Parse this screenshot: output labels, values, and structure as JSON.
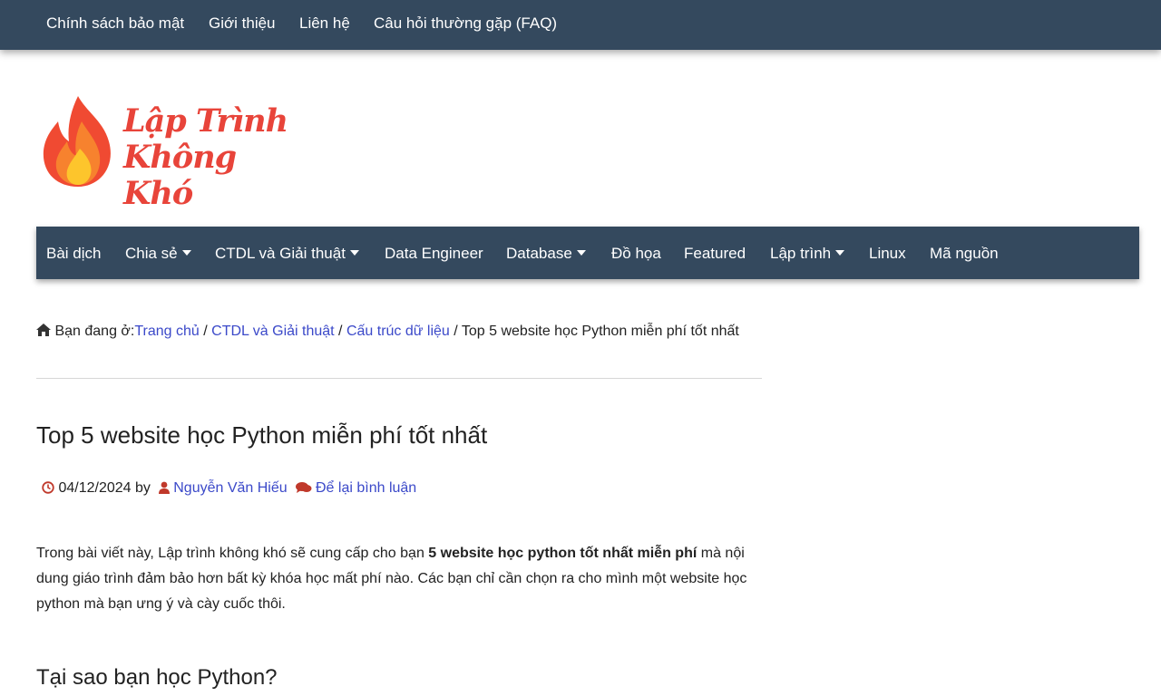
{
  "topbar": {
    "links": [
      "Chính sách bảo mật",
      "Giới thiệu",
      "Liên hệ",
      "Câu hỏi thường gặp (FAQ)"
    ]
  },
  "logo": {
    "text_line1": "Lập Trình",
    "text_line2": "Không Khó"
  },
  "mainnav": {
    "items": [
      {
        "label": "Bài dịch"
      },
      {
        "label": "Chia sẻ"
      },
      {
        "label": "CTDL và Giải thuật"
      },
      {
        "label": "Data Engineer"
      },
      {
        "label": "Database"
      },
      {
        "label": "Đồ họa"
      },
      {
        "label": "Featured"
      },
      {
        "label": "Lập trình"
      },
      {
        "label": "Linux"
      },
      {
        "label": "Mã nguồn"
      }
    ]
  },
  "breadcrumb": {
    "prefix": "Bạn đang ở:",
    "home": "Trang chủ",
    "sep": " / ",
    "level1": "CTDL và Giải thuật",
    "level2": "Cấu trúc dữ liệu",
    "current": "Top 5 website học Python miễn phí tốt nhất"
  },
  "article": {
    "title": "Top 5 website học Python miễn phí tốt nhất",
    "date": "04/12/2024",
    "by": "by",
    "author": "Nguyễn Văn Hiếu",
    "comment_link": "Để lại bình luận",
    "intro_before": "Trong bài viết này, Lập trình không khó sẽ cung cấp cho bạn ",
    "intro_bold": "5 website học python tốt nhất miễn phí",
    "intro_after": " mà nội dung giáo trình đảm bảo hơn bất kỳ khóa học mất phí nào. Các bạn chỉ cần chọn ra cho mình một website học python mà bạn ưng ý và cày cuốc thôi.",
    "subheading": "Tại sao bạn học Python?"
  },
  "colors": {
    "nav_bg": "#34495e",
    "link": "#3b49c9",
    "meta_icon": "#c0392b",
    "logo_red": "#e8443a"
  },
  "icons": [
    "home-icon",
    "clock-icon",
    "user-icon",
    "comments-icon",
    "flame-icon",
    "caret-down-icon"
  ]
}
